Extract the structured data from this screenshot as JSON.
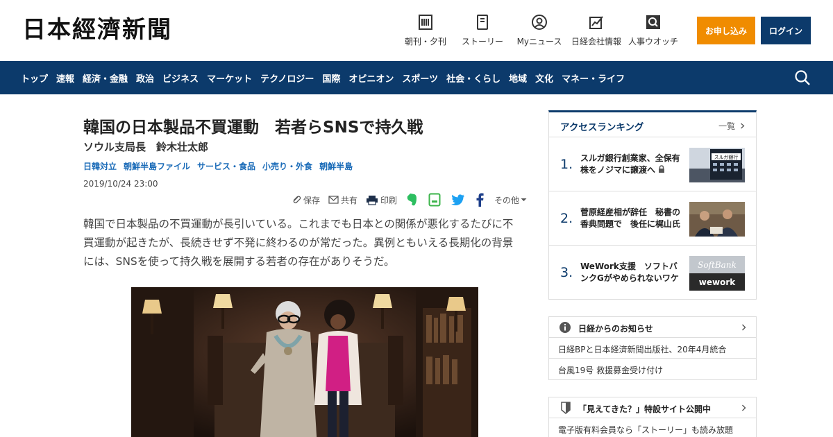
{
  "header": {
    "logo": "日本經濟新聞",
    "nav": [
      {
        "label": "朝刊・夕刊",
        "icon": "newspaper-icon"
      },
      {
        "label": "ストーリー",
        "icon": "book-icon"
      },
      {
        "label": "Myニュース",
        "icon": "user-icon"
      },
      {
        "label": "日経会社情報",
        "icon": "chart-icon"
      },
      {
        "label": "人事ウオッチ",
        "icon": "search-person-icon"
      }
    ],
    "subscribe_label": "お申し込み",
    "login_label": "ログイン"
  },
  "navbar": {
    "items": [
      "トップ",
      "速報",
      "経済・金融",
      "政治",
      "ビジネス",
      "マーケット",
      "テクノロジー",
      "国際",
      "オピニオン",
      "スポーツ",
      "社会・くらし",
      "地域",
      "文化",
      "マネー・ライフ"
    ]
  },
  "article": {
    "title": "韓国の日本製品不買運動　若者らSNSで持久戦",
    "byline": "ソウル支局長　鈴木壮太郎",
    "tags": [
      "日韓対立",
      "朝鮮半島ファイル",
      "サービス・食品",
      "小売り・外食",
      "朝鮮半島"
    ],
    "date": "2019/10/24 23:00",
    "tools": {
      "save": "保存",
      "share": "共有",
      "print": "印刷",
      "other": "その他"
    },
    "lead": "韓国で日本製品の不買運動が長引いている。これまでも日本との関係が悪化するたびに不買運動が起きたが、長続きせず不発に終わるのが常だった。異例ともいえる長期化の背景には、SNSを使って持久戦を展開する若者の存在がありそうだ。"
  },
  "ranking": {
    "title": "アクセスランキング",
    "more": "一覧",
    "items": [
      {
        "rank": "1.",
        "text": "スルガ銀行創業家、全保有株をノジマに譲渡へ",
        "locked": true
      },
      {
        "rank": "2.",
        "text": "菅原経産相が辞任　秘書の香典問題で　後任に梶山氏",
        "locked": false
      },
      {
        "rank": "3.",
        "text": "WeWork支援　ソフトバンクGがやめられないワケ",
        "locked": false
      }
    ],
    "thumb_texts": {
      "bank": "スルガ銀行",
      "softbank": "SoftBank",
      "wework": "wework"
    }
  },
  "notice": {
    "title": "日経からのお知らせ",
    "items": [
      "日経BPと日本経済新聞出版社、20年4月統合",
      "台風19号 救援募金受け付け"
    ]
  },
  "promo": {
    "title": "「見えてきた？」特設サイト公開中",
    "text": "電子版有料会員なら「ストーリー」も読み放題"
  },
  "colors": {
    "navy": "#0c3a6b",
    "orange": "#f08c00",
    "link": "#1a6bb8"
  }
}
